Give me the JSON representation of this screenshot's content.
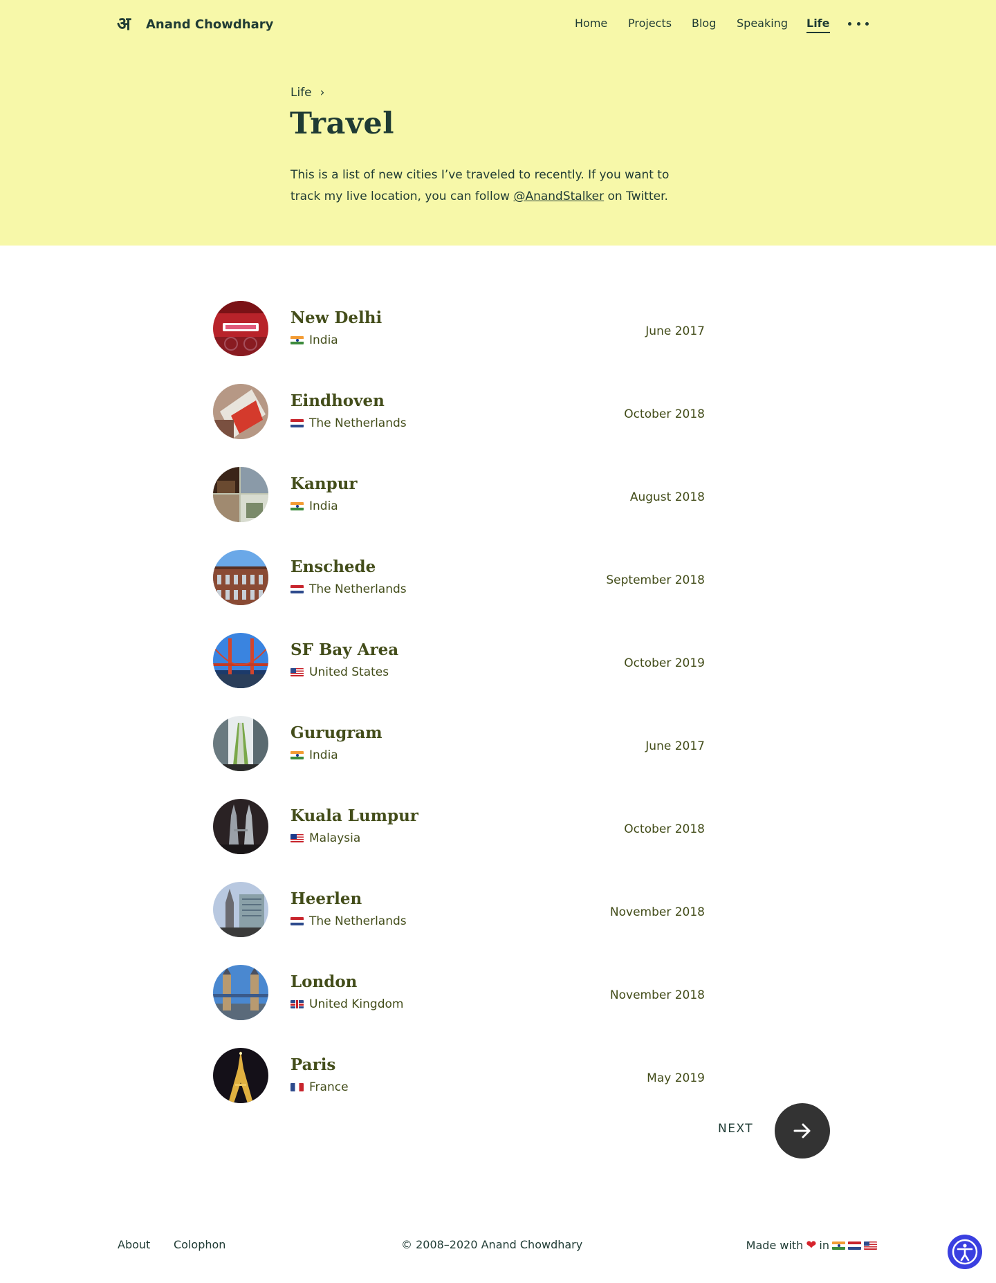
{
  "brand": {
    "logo_mark": "अ",
    "name": "Anand Chowdhary"
  },
  "nav": {
    "items": [
      {
        "label": "Home"
      },
      {
        "label": "Projects"
      },
      {
        "label": "Blog"
      },
      {
        "label": "Speaking"
      },
      {
        "label": "Life",
        "active": true
      }
    ],
    "more_icon": "more-horizontal-icon"
  },
  "breadcrumb": {
    "parent": "Life",
    "separator": "›"
  },
  "page": {
    "title": "Travel",
    "intro_before": "This is a list of new cities I’ve traveled to recently. If you want to track my live location, you can follow ",
    "intro_link": "@AnandStalker",
    "intro_after": " on Twitter."
  },
  "trips": [
    {
      "city": "New Delhi",
      "country": "India",
      "flag": "india-flag",
      "date": "June 2017"
    },
    {
      "city": "Eindhoven",
      "country": "The Netherlands",
      "flag": "netherlands-flag",
      "date": "October 2018"
    },
    {
      "city": "Kanpur",
      "country": "India",
      "flag": "india-flag",
      "date": "August 2018"
    },
    {
      "city": "Enschede",
      "country": "The Netherlands",
      "flag": "netherlands-flag",
      "date": "September 2018"
    },
    {
      "city": "SF Bay Area",
      "country": "United States",
      "flag": "united-states-flag",
      "date": "October 2019"
    },
    {
      "city": "Gurugram",
      "country": "India",
      "flag": "india-flag",
      "date": "June 2017"
    },
    {
      "city": "Kuala Lumpur",
      "country": "Malaysia",
      "flag": "malaysia-flag",
      "date": "October 2018"
    },
    {
      "city": "Heerlen",
      "country": "The Netherlands",
      "flag": "netherlands-flag",
      "date": "November 2018"
    },
    {
      "city": "London",
      "country": "United Kingdom",
      "flag": "united-kingdom-flag",
      "date": "November 2018"
    },
    {
      "city": "Paris",
      "country": "France",
      "flag": "france-flag",
      "date": "May 2019"
    }
  ],
  "pagination": {
    "next_label": "NEXT",
    "next_icon": "arrow-right-icon"
  },
  "footer": {
    "links": [
      {
        "label": "About"
      },
      {
        "label": "Colophon"
      }
    ],
    "copyright": "© 2008–2020 Anand Chowdhary",
    "made_with": "Made with",
    "made_in": "in",
    "heart_icon": "heart-icon",
    "flags": [
      "india-flag",
      "netherlands-flag",
      "united-states-flag"
    ]
  },
  "accessibility_icon": "accessibility-icon",
  "colors": {
    "hero_background": "#f7f8a9",
    "heading": "#1f3b34",
    "list_text": "#434d1a",
    "next_button": "#333333",
    "accessibility_button": "#3a3fe0"
  }
}
